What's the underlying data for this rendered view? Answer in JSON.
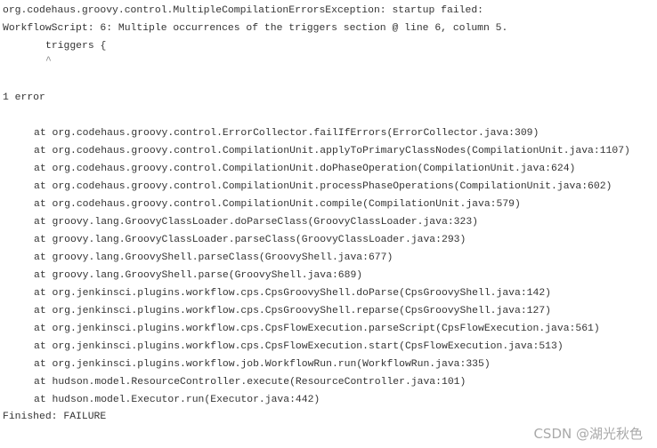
{
  "console": {
    "header_lines": [
      "org.codehaus.groovy.control.MultipleCompilationErrorsException: startup failed:",
      "WorkflowScript: 6: Multiple occurrences of the triggers section @ line 6, column 5."
    ],
    "code_line": "triggers {",
    "caret": "^",
    "error_count": "1 error",
    "stack_trace": [
      "at org.codehaus.groovy.control.ErrorCollector.failIfErrors(ErrorCollector.java:309)",
      "at org.codehaus.groovy.control.CompilationUnit.applyToPrimaryClassNodes(CompilationUnit.java:1107)",
      "at org.codehaus.groovy.control.CompilationUnit.doPhaseOperation(CompilationUnit.java:624)",
      "at org.codehaus.groovy.control.CompilationUnit.processPhaseOperations(CompilationUnit.java:602)",
      "at org.codehaus.groovy.control.CompilationUnit.compile(CompilationUnit.java:579)",
      "at groovy.lang.GroovyClassLoader.doParseClass(GroovyClassLoader.java:323)",
      "at groovy.lang.GroovyClassLoader.parseClass(GroovyClassLoader.java:293)",
      "at groovy.lang.GroovyShell.parseClass(GroovyShell.java:677)",
      "at groovy.lang.GroovyShell.parse(GroovyShell.java:689)",
      "at org.jenkinsci.plugins.workflow.cps.CpsGroovyShell.doParse(CpsGroovyShell.java:142)",
      "at org.jenkinsci.plugins.workflow.cps.CpsGroovyShell.reparse(CpsGroovyShell.java:127)",
      "at org.jenkinsci.plugins.workflow.cps.CpsFlowExecution.parseScript(CpsFlowExecution.java:561)",
      "at org.jenkinsci.plugins.workflow.cps.CpsFlowExecution.start(CpsFlowExecution.java:513)",
      "at org.jenkinsci.plugins.workflow.job.WorkflowRun.run(WorkflowRun.java:335)",
      "at hudson.model.ResourceController.execute(ResourceController.java:101)",
      "at hudson.model.Executor.run(Executor.java:442)"
    ],
    "finished": "Finished: FAILURE"
  },
  "watermark": "CSDN @湖光秋色"
}
